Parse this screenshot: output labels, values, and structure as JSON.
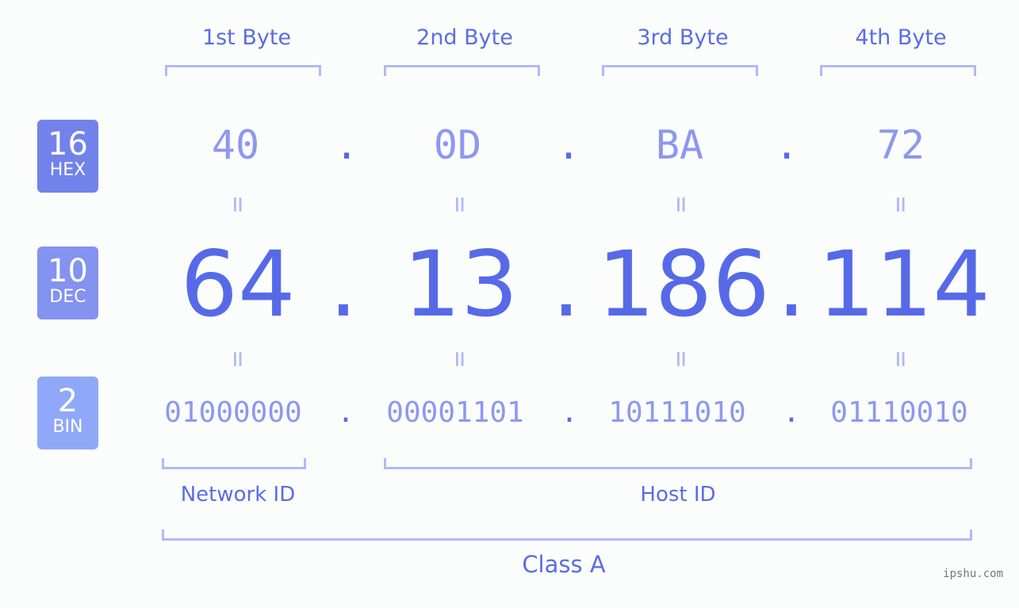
{
  "bytes": [
    {
      "label": "1st Byte",
      "hex": "40",
      "dec": "64",
      "bin": "01000000"
    },
    {
      "label": "2nd Byte",
      "hex": "0D",
      "dec": "13",
      "bin": "00001101"
    },
    {
      "label": "3rd Byte",
      "hex": "BA",
      "dec": "186",
      "bin": "10111010"
    },
    {
      "label": "4th Byte",
      "hex": "72",
      "dec": "114",
      "bin": "01110010"
    }
  ],
  "badges": {
    "hex": {
      "num": "16",
      "label": "HEX",
      "color": "#7282eb"
    },
    "dec": {
      "num": "10",
      "label": "DEC",
      "color": "#8492f0"
    },
    "bin": {
      "num": "2",
      "label": "BIN",
      "color": "#90a8f8"
    }
  },
  "separator": ".",
  "equals": "=",
  "sections": {
    "network": "Network ID",
    "host": "Host ID",
    "class": "Class A"
  },
  "watermark": "ipshu.com",
  "colors": {
    "accent": "#566ae8",
    "light": "#b0baf5",
    "mid": "#8c98ee"
  }
}
